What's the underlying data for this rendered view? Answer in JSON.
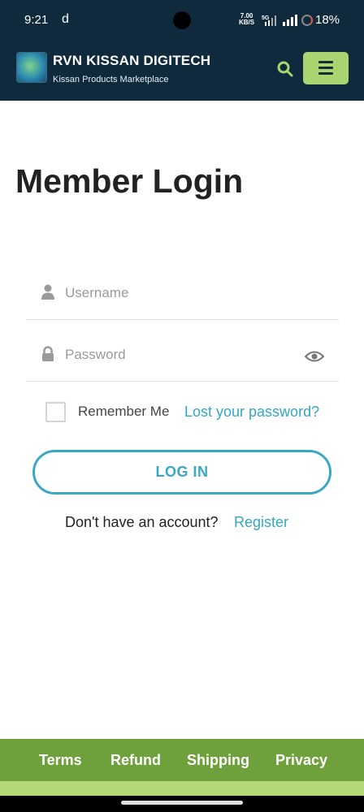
{
  "status_bar": {
    "time": "9:21",
    "app_indicator": "d",
    "speed_value": "7.00",
    "speed_unit": "KB/S",
    "network": "5G",
    "battery": "18%"
  },
  "header": {
    "brand_title": "RVN KISSAN DIGITECH",
    "brand_subtitle": "Kissan Products Marketplace",
    "logo_icon": "globe-logo-icon",
    "search_icon": "search-icon",
    "menu_icon": "hamburger-menu-icon",
    "accent_color": "#a9d46f",
    "background_color": "#0f2a3d"
  },
  "login": {
    "page_title": "Member Login",
    "username_placeholder": "Username",
    "username_value": "",
    "password_placeholder": "Password",
    "password_value": "",
    "remember_label": "Remember Me",
    "remember_checked": false,
    "lost_password_link": "Lost your password?",
    "login_button": "LOG IN",
    "no_account_text": "Don't have an account?",
    "register_link": "Register",
    "link_color": "#34a7c1"
  },
  "footer": {
    "links": [
      "Terms",
      "Refund",
      "Shipping",
      "Privacy"
    ],
    "background_color": "#6ea13c"
  }
}
